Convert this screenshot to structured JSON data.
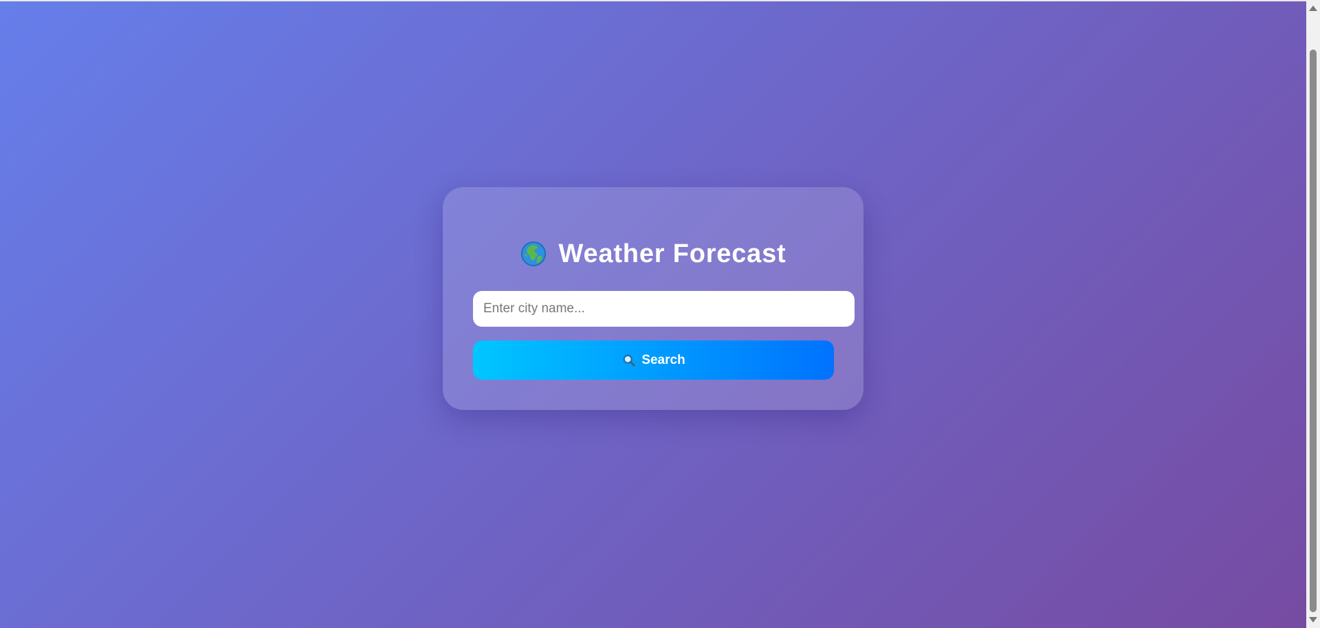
{
  "page": {
    "title": "Weather Forecast",
    "title_icon": "globe-icon"
  },
  "search": {
    "placeholder": "Enter city name...",
    "value": "",
    "button_label": "Search",
    "button_icon": "search-icon"
  },
  "colors": {
    "background_start": "#667eea",
    "background_end": "#764ba2",
    "button_start": "#00c6ff",
    "button_end": "#0072ff",
    "card_overlay": "rgba(255,255,255,0.15)"
  },
  "scrollbar": {
    "up_icon": "scroll-up-arrow-icon",
    "down_icon": "scroll-down-arrow-icon"
  }
}
